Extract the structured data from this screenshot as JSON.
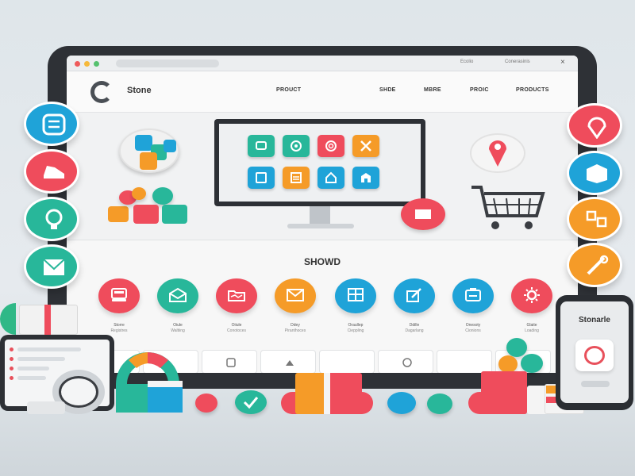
{
  "browser": {
    "bar_text_1": "Ecolio",
    "bar_text_2": "Conerasinis"
  },
  "nav": {
    "logo_text": "Stone",
    "items": [
      "PROUCT",
      "SHDE",
      "MBRE",
      "PROIC",
      "PRODUCTS"
    ]
  },
  "section": {
    "title": "SHOWD",
    "categories": [
      {
        "label": "Storre",
        "sub": "Registres",
        "color": "#ef4c5c",
        "icon": "register-icon"
      },
      {
        "label": "Oiule",
        "sub": "Waltiing",
        "color": "#28b79a",
        "icon": "envelope-open-icon"
      },
      {
        "label": "Oiiule",
        "sub": "Conotoces",
        "color": "#ef4c5c",
        "icon": "folder-icon"
      },
      {
        "label": "Ddey",
        "sub": "Piranthoces",
        "color": "#f59b28",
        "icon": "mail-icon"
      },
      {
        "label": "Oraullep",
        "sub": "Cieppling",
        "color": "#1fa3d8",
        "icon": "grid-icon"
      },
      {
        "label": "Ddille",
        "sub": "Dagarlang",
        "color": "#1fa3d8",
        "icon": "edit-icon"
      },
      {
        "label": "Onesoty",
        "sub": "Cionions",
        "color": "#1fa3d8",
        "icon": "document-icon"
      },
      {
        "label": "Glaite",
        "sub": "Loading",
        "color": "#ef4c5c",
        "icon": "gear-icon"
      }
    ]
  },
  "phone": {
    "title": "Stonarle"
  },
  "colors": {
    "red": "#ef4c5c",
    "teal": "#28b79a",
    "orange": "#f59b28",
    "blue": "#1fa3d8",
    "frame": "#2e3136"
  },
  "side_icons": {
    "left": [
      "list-icon",
      "shoe-icon",
      "lightbulb-icon",
      "envelope-icon"
    ],
    "right": [
      "map-pin-icon",
      "box-icon",
      "puzzle-icon",
      "tools-icon"
    ]
  }
}
